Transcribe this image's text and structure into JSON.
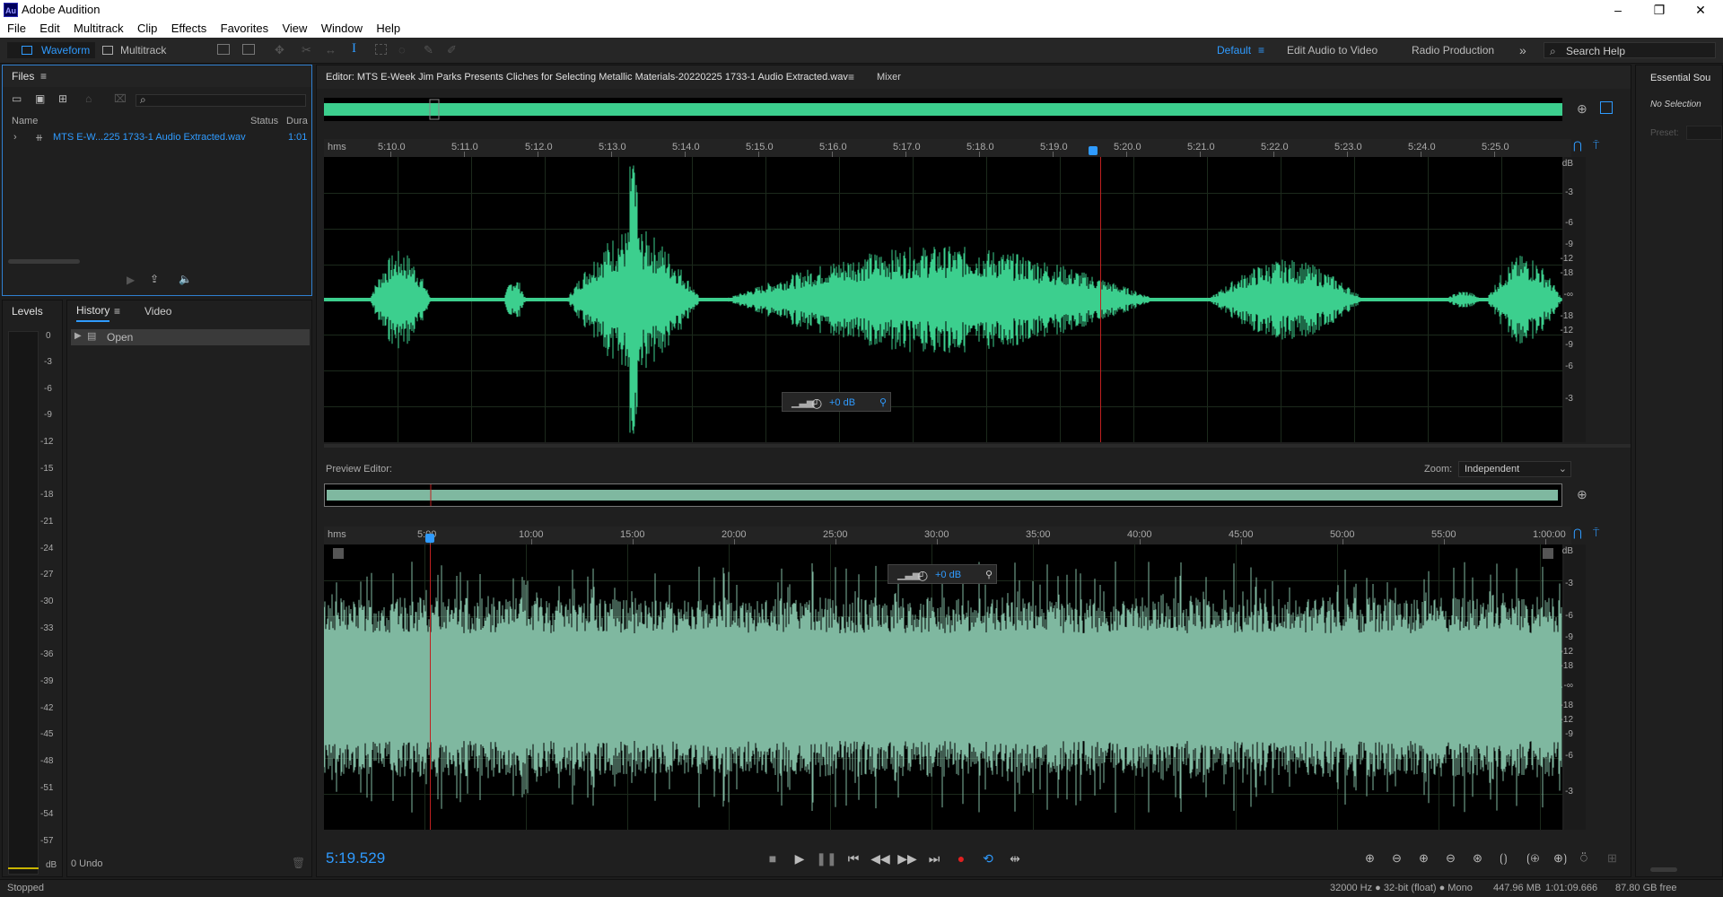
{
  "app": {
    "logo_text": "Au",
    "title": "Adobe Audition",
    "window_controls": [
      "–",
      "❐",
      "✕"
    ]
  },
  "menu": [
    "File",
    "Edit",
    "Multitrack",
    "Clip",
    "Effects",
    "Favorites",
    "View",
    "Window",
    "Help"
  ],
  "toolbar": {
    "waveform_label": "Waveform",
    "multitrack_label": "Multitrack",
    "workspaces": [
      "Default",
      "Edit Audio to Video",
      "Radio Production"
    ],
    "more_icon": "»",
    "search_placeholder": "Search Help"
  },
  "files_panel": {
    "title": "Files",
    "columns": [
      "Name",
      "Status",
      "Dura"
    ],
    "file": {
      "name": "MTS E-W...225 1733-1 Audio Extracted.wav",
      "duration": "1:01"
    }
  },
  "levels_panel": {
    "title": "Levels",
    "scale": [
      "0",
      "-3",
      "-6",
      "-9",
      "-12",
      "-15",
      "-18",
      "-21",
      "-24",
      "-27",
      "-30",
      "-33",
      "-36",
      "-39",
      "-42",
      "-45",
      "-48",
      "-51",
      "-54",
      "-57",
      "dB"
    ]
  },
  "history_panel": {
    "tabs": [
      "History",
      "Video"
    ],
    "item": "Open",
    "undo_count": "0 Undo"
  },
  "editor": {
    "tab_title": "Editor: MTS E-Week Jim Parks Presents Cliches for Selecting Metallic Materials-20220225 1733-1 Audio Extracted.wav",
    "mixer_tab": "Mixer",
    "ruler_unit": "hms",
    "ruler_labels": [
      "5:10.0",
      "5:11.0",
      "5:12.0",
      "5:13.0",
      "5:14.0",
      "5:15.0",
      "5:16.0",
      "5:17.0",
      "5:18.0",
      "5:19.0",
      "5:20.0",
      "5:21.0",
      "5:22.0",
      "5:23.0",
      "5:24.0",
      "5:25.0"
    ],
    "db_scale": [
      "dB",
      "-3",
      "-6",
      "-9",
      "-12",
      "-18",
      "-∞",
      "-18",
      "-12",
      "-9",
      "-6",
      "-3"
    ],
    "hud_gain": "+0 dB"
  },
  "preview": {
    "label": "Preview Editor:",
    "zoom_label": "Zoom:",
    "zoom_value": "Independent",
    "ruler_unit": "hms",
    "ruler_labels": [
      "5:00",
      "10:00",
      "15:00",
      "20:00",
      "25:00",
      "30:00",
      "35:00",
      "40:00",
      "45:00",
      "50:00",
      "55:00",
      "1:00:00"
    ],
    "db_scale": [
      "dB",
      "-3",
      "-6",
      "-9",
      "-12",
      "-18",
      "-∞",
      "-18",
      "-12",
      "-9",
      "-6",
      "-3"
    ],
    "hud_gain": "+0 dB"
  },
  "transport": {
    "time": "5:19.529"
  },
  "essential_panel": {
    "title": "Essential Sou",
    "no_selection": "No Selection",
    "preset_label": "Preset:"
  },
  "status": {
    "left": "Stopped",
    "sample_info": "32000 Hz ● 32-bit (float) ● Mono",
    "size": "447.96 MB",
    "duration": "1:01:09.666",
    "free": "87.80 GB free"
  },
  "colors": {
    "accent": "#2f9bff",
    "wave_main": "#3ccf8e",
    "wave_preview": "#7fb8a0",
    "playhead": "#d02020"
  }
}
